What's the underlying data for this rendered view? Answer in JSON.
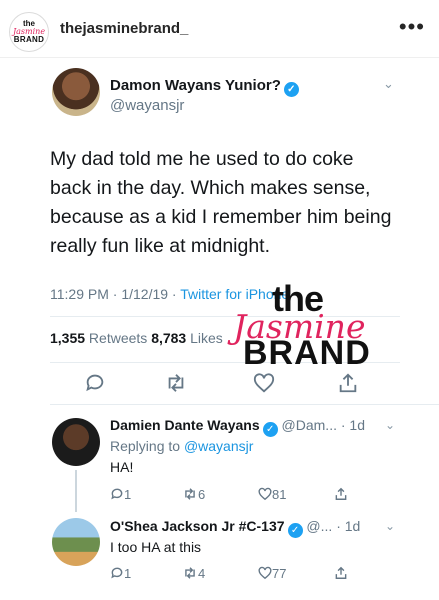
{
  "instagram": {
    "avatar": {
      "line1": "the",
      "line2": "Jasmine",
      "line3": "BRAND"
    },
    "username": "thejasminebrand_",
    "more": "•••"
  },
  "tweet": {
    "name": "Damon Wayans Yunior?",
    "verified": "✓",
    "handle": "@wayansjr",
    "chevron": "⌄",
    "text": "My dad told me he used to do coke back in the day. Which makes sense, because as a kid I remember him being really fun like at midnight.",
    "time": "11:29 PM · 1/12/19 · ",
    "source": "Twitter for iPhone",
    "retweets": "1,355",
    "retweets_label": " Retweets ",
    "likes": "8,783",
    "likes_label": " Likes",
    "icons": {
      "reply": "reply-icon",
      "retweet": "retweet-icon",
      "like": "heart-icon",
      "share": "share-icon"
    }
  },
  "watermark": {
    "the": "the",
    "jasmine": "Jasmine",
    "brand": "BRAND"
  },
  "replies": [
    {
      "name": "Damien Dante Wayans",
      "verified": "✓",
      "handle_time": " @Dam... · 1d",
      "replying_prefix": "Replying to ",
      "replying_to": "@wayansjr",
      "text": "HA!",
      "reply_count": "1",
      "retweet_count": "6",
      "like_count": "81"
    },
    {
      "name": "O'Shea Jackson Jr #C-137",
      "verified": "✓",
      "handle_time": " @... · 1d",
      "text": "I too HA at this",
      "reply_count": "1",
      "retweet_count": "4",
      "like_count": "77"
    }
  ]
}
